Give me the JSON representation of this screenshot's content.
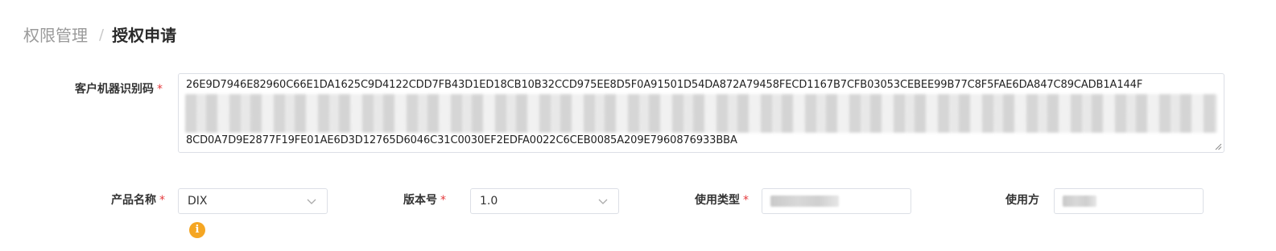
{
  "breadcrumb": {
    "parent": "权限管理",
    "separator": "/",
    "current": "授权申请"
  },
  "form": {
    "machine_code": {
      "label": "客户机器识别码",
      "required_mark": "*",
      "line_first": "26E9D7946E82960C66E1DA1625C9D4122CDD7FB43D1ED18CB10B32CCD975EE8D5F0A91501D54DA872A79458FECD1167B7CFB03053CEBEE99B77C8F5FAE6DA847C89CADB1A144F",
      "line_last": "8CD0A7D9E2877F19FE01AE6D3D12765D6046C31C0030EF2EDFA0022C6CEB0085A209E7960876933BBA"
    },
    "product_name": {
      "label": "产品名称",
      "required_mark": "*",
      "value": "DIX"
    },
    "version": {
      "label": "版本号",
      "required_mark": "*",
      "value": "1.0"
    },
    "usage_type": {
      "label": "使用类型",
      "required_mark": "*"
    },
    "user": {
      "label": "使用方"
    },
    "info_icon": "info-icon"
  },
  "colors": {
    "required": "#e4393c",
    "info": "#f5a623",
    "border": "#dcdfe6"
  }
}
